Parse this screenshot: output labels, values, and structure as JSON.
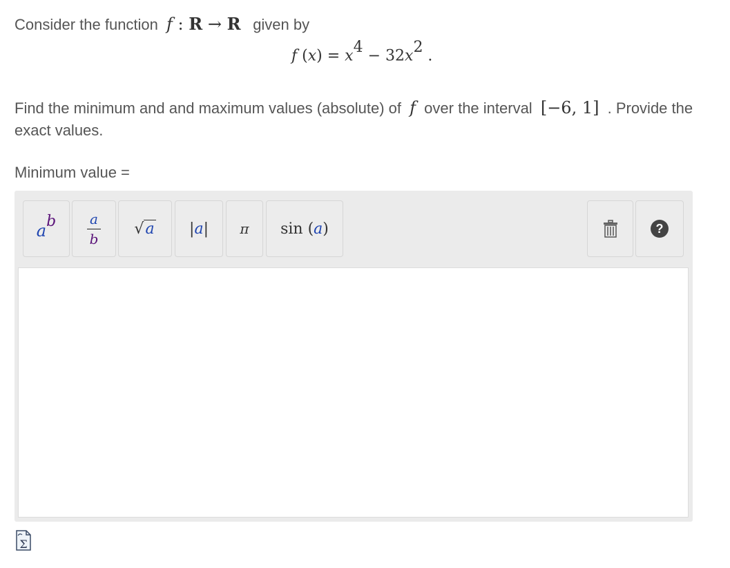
{
  "intro": {
    "prefix": "Consider the function",
    "math": "f : R → R",
    "suffix": "given by"
  },
  "formula": {
    "lhs": "f (x) = ",
    "term1_base": "x",
    "term1_exp": "4",
    "op": " − 32x",
    "term2_exp": "2",
    "tail": " ."
  },
  "task": {
    "part1": "Find the minimum and and maximum values (absolute) of",
    "f": "f",
    "part2": "over the interval",
    "interval": "[−6, 1]",
    "part3": ". Provide the exact values."
  },
  "minimum_label": "Minimum value =",
  "toolbar": {
    "power": {
      "base": "a",
      "exp": "b"
    },
    "fraction": {
      "num": "a",
      "den": "b"
    },
    "sqrt": {
      "arg": "a"
    },
    "abs": {
      "text": "|a|"
    },
    "pi": {
      "text": "π"
    },
    "sin": {
      "fn": "sin",
      "arg": "a"
    },
    "icons": [
      "trash-icon",
      "help-icon"
    ]
  },
  "answer": {
    "value": ""
  },
  "footer_icon": "sigma-icon"
}
